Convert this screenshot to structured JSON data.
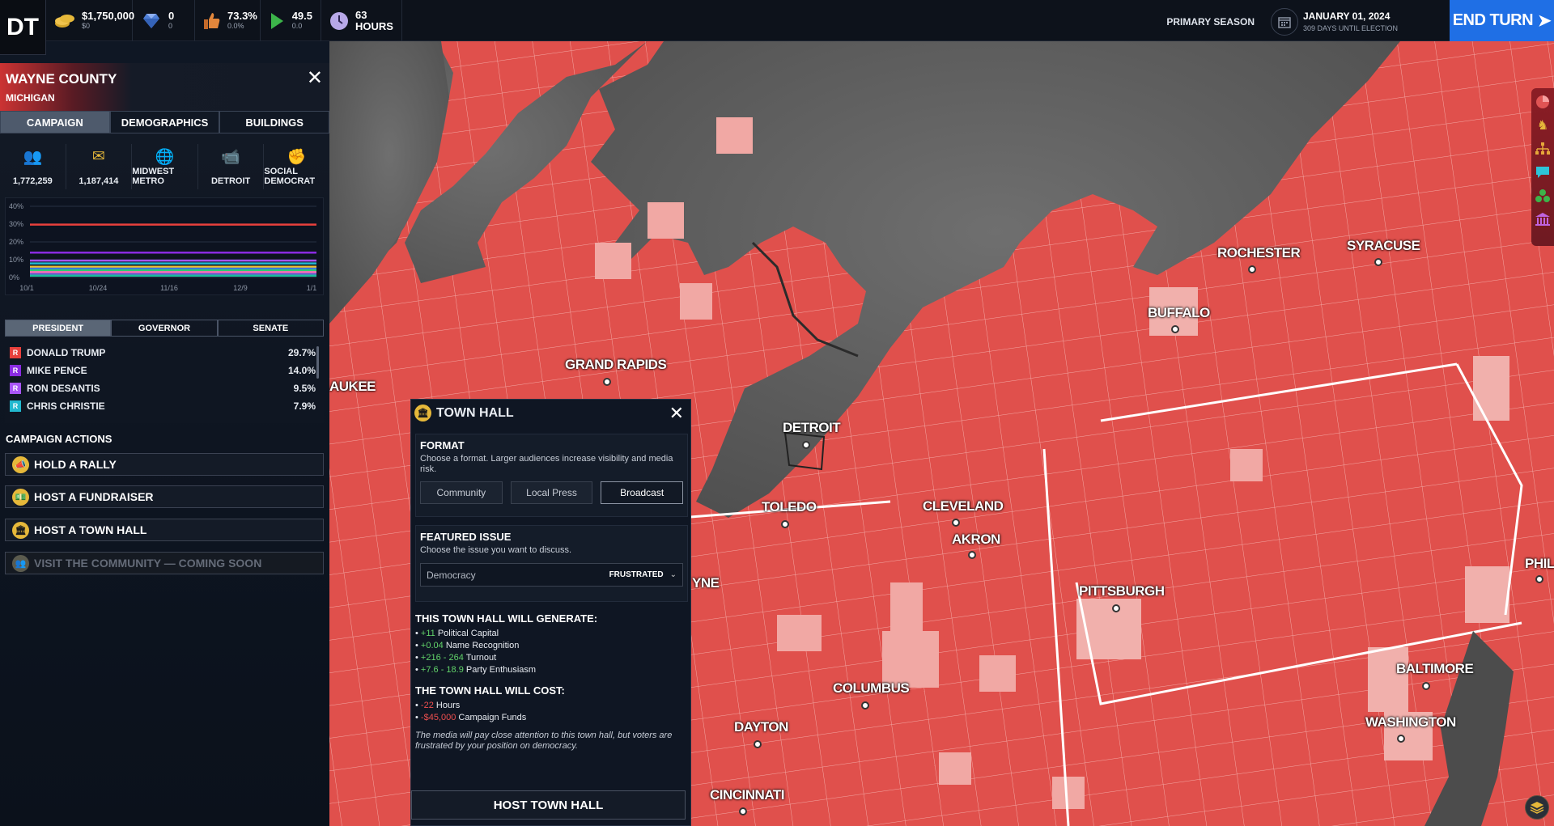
{
  "topbar": {
    "logo": "DT",
    "funds": {
      "value": "$1,750,000",
      "change": "$0",
      "icon": "coins-icon"
    },
    "capital": {
      "value": "0",
      "change": "0",
      "icon": "gem-icon"
    },
    "approval": {
      "value": "73.3%",
      "change": "0.0%",
      "icon": "thumbs-up-icon"
    },
    "momentum": {
      "value": "49.5",
      "change": "0.0",
      "icon": "flag-icon"
    },
    "time": {
      "value": "63 HOURS",
      "icon": "clock-icon"
    },
    "season": "PRIMARY SEASON",
    "date": "JANUARY 01, 2024",
    "days_until": "309 DAYS UNTIL ELECTION",
    "end_turn": "END TURN"
  },
  "county": {
    "name": "WAYNE COUNTY",
    "state": "MICHIGAN",
    "tabs": [
      "CAMPAIGN",
      "DEMOGRAPHICS",
      "BUILDINGS"
    ],
    "active_tab": 0,
    "stats": [
      {
        "icon": "population-icon",
        "glyph": "👥",
        "value": "1,772,259"
      },
      {
        "icon": "voters-icon",
        "glyph": "✉",
        "value": "1,187,414"
      },
      {
        "icon": "region-globe-icon",
        "glyph": "🌐",
        "value": "MIDWEST METRO"
      },
      {
        "icon": "media-market-icon",
        "glyph": "📹",
        "value": "DETROIT"
      },
      {
        "icon": "ideology-fist-icon",
        "glyph": "✊",
        "value": "SOCIAL DEMOCRAT"
      }
    ]
  },
  "chart_data": {
    "type": "line",
    "x": [
      "10/1",
      "10/24",
      "11/16",
      "12/9",
      "1/1"
    ],
    "y_ticks": [
      "40%",
      "30%",
      "20%",
      "10%",
      "0%"
    ],
    "ylim": [
      0,
      40
    ],
    "series": [
      {
        "color": "#e8403c",
        "value": 29.7
      },
      {
        "color": "#8a2be2",
        "value": 14.0
      },
      {
        "color": "#a855f7",
        "value": 9.5
      },
      {
        "color": "#22b8cf",
        "value": 7.9
      },
      {
        "color": "#f0c030",
        "value": 6.0
      },
      {
        "color": "#3a7bd5",
        "value": 5.0
      },
      {
        "color": "#2ecc71",
        "value": 4.0
      },
      {
        "color": "#ff6fb5",
        "value": 3.0
      },
      {
        "color": "#6a5acd",
        "value": 2.0
      },
      {
        "color": "#1abc9c",
        "value": 1.0
      }
    ]
  },
  "races": {
    "tabs": [
      "PRESIDENT",
      "GOVERNOR",
      "SENATE"
    ],
    "active": 0,
    "candidates": [
      {
        "party": "R",
        "name": "DONALD TRUMP",
        "pct": "29.7%",
        "color": "#e8403c"
      },
      {
        "party": "R",
        "name": "MIKE PENCE",
        "pct": "14.0%",
        "color": "#8a2be2"
      },
      {
        "party": "R",
        "name": "RON DESANTIS",
        "pct": "9.5%",
        "color": "#a855f7"
      },
      {
        "party": "R",
        "name": "CHRIS CHRISTIE",
        "pct": "7.9%",
        "color": "#22b8cf"
      }
    ]
  },
  "actions": {
    "title": "CAMPAIGN ACTIONS",
    "items": [
      {
        "label": "HOLD A RALLY",
        "icon": "megaphone-icon"
      },
      {
        "label": "HOST A FUNDRAISER",
        "icon": "money-icon"
      },
      {
        "label": "HOST A TOWN HALL",
        "icon": "town-hall-icon"
      },
      {
        "label": "VISIT THE COMMUNITY — COMING SOON",
        "icon": "community-icon"
      }
    ]
  },
  "townhall": {
    "title": "TOWN HALL",
    "format_title": "FORMAT",
    "format_desc": "Choose a format. Larger audiences increase visibility and media risk.",
    "formats": [
      "Community",
      "Local Press",
      "Broadcast"
    ],
    "selected_format": 2,
    "issue_title": "FEATURED ISSUE",
    "issue_desc": "Choose the issue you want to discuss.",
    "issue_value": "Democracy",
    "issue_mood": "FRUSTRATED",
    "generate_title": "THIS TOWN HALL WILL GENERATE:",
    "generate": [
      {
        "amount": "+11",
        "label": "Political Capital",
        "tone": "pos"
      },
      {
        "amount": "+0.04",
        "label": "Name Recognition",
        "tone": "pos"
      },
      {
        "amount": "+216 - 264",
        "label": "Turnout",
        "tone": "pos"
      },
      {
        "amount": "+7.6 - 18.9",
        "label": "Party Enthusiasm",
        "tone": "pos"
      }
    ],
    "cost_title": "THE TOWN HALL WILL COST:",
    "costs": [
      {
        "amount": "-22",
        "label": "Hours"
      },
      {
        "amount": "-$45,000",
        "label": "Campaign Funds"
      }
    ],
    "note": "The media will pay close attention to this town hall, but voters are frustrated by your position on democracy.",
    "host_button": "HOST TOWN HALL"
  },
  "map": {
    "cities": [
      {
        "name": "GRAND RAPIDS"
      },
      {
        "name": "DETROIT"
      },
      {
        "name": "TOLEDO"
      },
      {
        "name": "CLEVELAND"
      },
      {
        "name": "AKRON"
      },
      {
        "name": "PITTSBURGH"
      },
      {
        "name": "COLUMBUS"
      },
      {
        "name": "DAYTON"
      },
      {
        "name": "CINCINNATI"
      },
      {
        "name": "ROCHESTER"
      },
      {
        "name": "SYRACUSE"
      },
      {
        "name": "BUFFALO"
      },
      {
        "name": "BALTIMORE"
      },
      {
        "name": "WASHINGTON"
      },
      {
        "name": "PHILADEL"
      },
      {
        "name": "AUKEE"
      },
      {
        "name": "YNE"
      }
    ]
  },
  "rail": [
    "pie-chart-icon",
    "chess-knight-icon",
    "org-chart-icon",
    "chat-icon",
    "hexagons-icon",
    "capitol-icon"
  ]
}
